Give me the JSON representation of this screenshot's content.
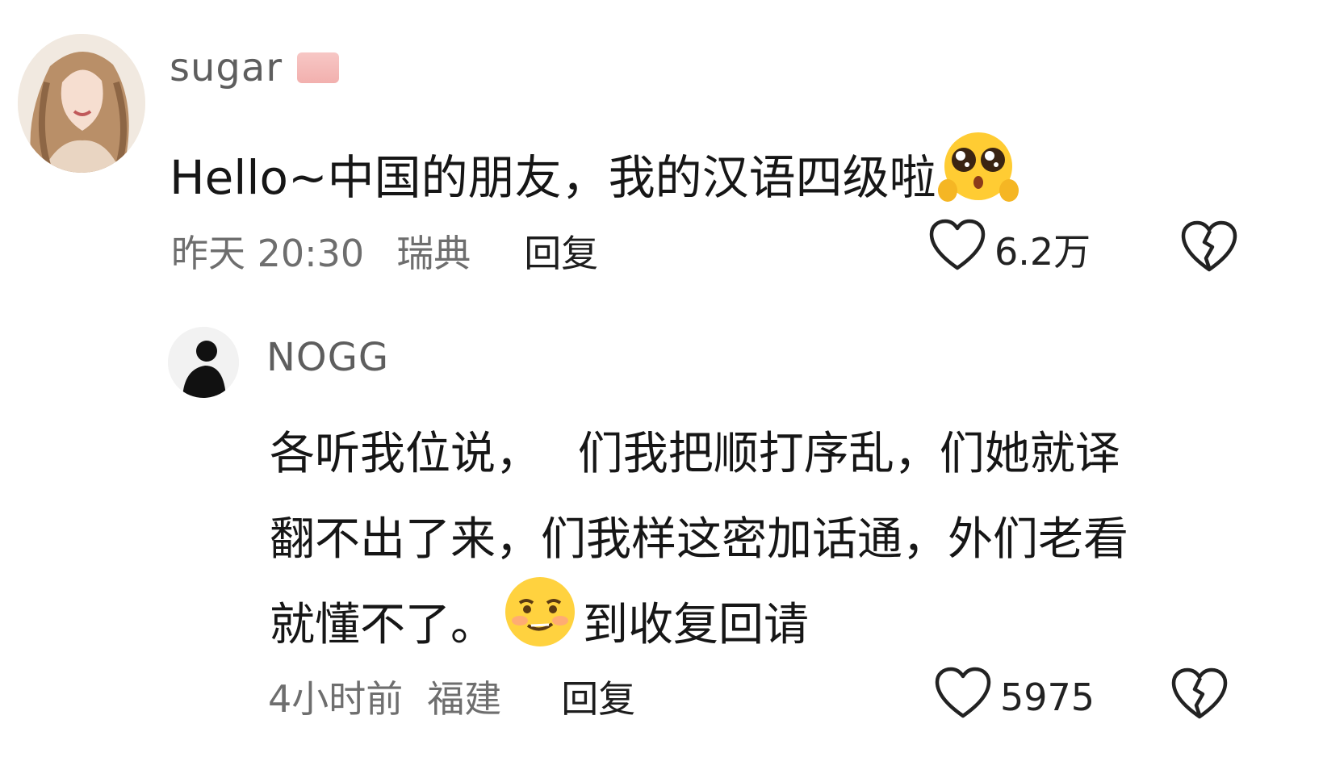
{
  "comment": {
    "username": "sugar",
    "flag_icon": "flag-icon",
    "text": "Hello~中国的朋友，我的汉语四级啦",
    "emoji": "pleading-face-emoji",
    "time": "昨天 20:30",
    "region": "瑞典",
    "reply_label": "回复",
    "likes": "6.2万"
  },
  "reply": {
    "username": "NOGG",
    "lines": [
      "各听我位说，　 们我把顺打序乱，们她就译",
      "翻不出了来，们我样这密加话通，外们老看",
      "就懂不了。"
    ],
    "line3_after_emoji": "到收复回请",
    "emoji": "blushing-smile-emoji",
    "time": "4小时前",
    "region": "福建",
    "reply_label": "回复",
    "likes": "5975"
  }
}
